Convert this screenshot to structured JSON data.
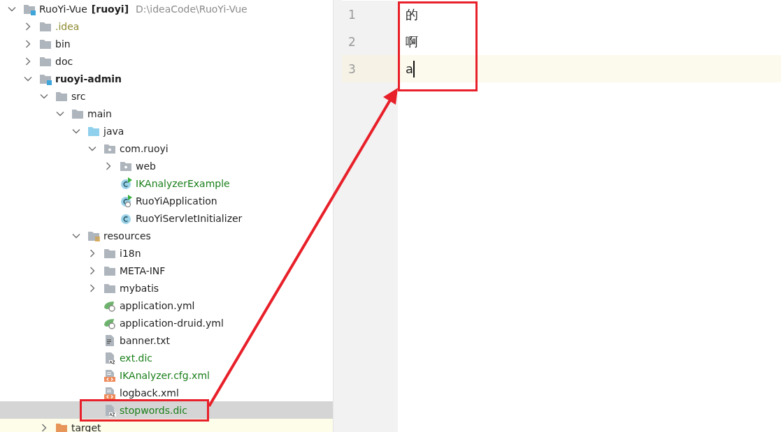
{
  "project_tree": {
    "items": [
      {
        "label": "RuoYi-Vue",
        "badge": "[ruoyi]",
        "path": "D:\\ideaCode\\RuoYi-Vue",
        "kind": "module",
        "expanded": true,
        "selected": false,
        "children": [
          {
            "label": ".idea",
            "kind": "folder",
            "expanded": false,
            "selected": false,
            "color": "#8c8a2f"
          },
          {
            "label": "bin",
            "kind": "folder",
            "expanded": false,
            "selected": false
          },
          {
            "label": "doc",
            "kind": "folder",
            "expanded": false,
            "selected": false
          },
          {
            "label": "ruoyi-admin",
            "kind": "module",
            "bold": true,
            "expanded": true,
            "selected": false,
            "children": [
              {
                "label": "src",
                "kind": "folder",
                "expanded": true,
                "selected": false,
                "children": [
                  {
                    "label": "main",
                    "kind": "folder",
                    "expanded": true,
                    "selected": false,
                    "children": [
                      {
                        "label": "java",
                        "kind": "source-folder",
                        "expanded": true,
                        "selected": false,
                        "children": [
                          {
                            "label": "com.ruoyi",
                            "kind": "package",
                            "expanded": true,
                            "selected": false,
                            "children": [
                              {
                                "label": "web",
                                "kind": "package",
                                "expanded": false,
                                "selected": false
                              },
                              {
                                "label": "IKAnalyzerExample",
                                "kind": "main-class",
                                "selected": false,
                                "color": "#1a7f1a"
                              },
                              {
                                "label": "RuoYiApplication",
                                "kind": "boot-class",
                                "selected": false
                              },
                              {
                                "label": "RuoYiServletInitializer",
                                "kind": "class",
                                "selected": false
                              }
                            ]
                          }
                        ]
                      },
                      {
                        "label": "resources",
                        "kind": "resources-folder",
                        "expanded": true,
                        "selected": false,
                        "children": [
                          {
                            "label": "i18n",
                            "kind": "folder",
                            "expanded": false,
                            "selected": false
                          },
                          {
                            "label": "META-INF",
                            "kind": "folder",
                            "expanded": false,
                            "selected": false
                          },
                          {
                            "label": "mybatis",
                            "kind": "folder",
                            "expanded": false,
                            "selected": false
                          },
                          {
                            "label": "application.yml",
                            "kind": "spring-config",
                            "selected": false
                          },
                          {
                            "label": "application-druid.yml",
                            "kind": "spring-config",
                            "selected": false
                          },
                          {
                            "label": "banner.txt",
                            "kind": "text-file",
                            "selected": false
                          },
                          {
                            "label": "ext.dic",
                            "kind": "dic-file",
                            "selected": false,
                            "color": "#1a7f1a"
                          },
                          {
                            "label": "IKAnalyzer.cfg.xml",
                            "kind": "xml-file",
                            "selected": false,
                            "color": "#1a7f1a"
                          },
                          {
                            "label": "logback.xml",
                            "kind": "xml-file",
                            "selected": false
                          },
                          {
                            "label": "stopwords.dic",
                            "kind": "dic-file",
                            "selected": true,
                            "color": "#1a7f1a"
                          }
                        ]
                      }
                    ]
                  }
                ]
              },
              {
                "label": "target",
                "kind": "excluded-folder",
                "expanded": false,
                "selected": false
              }
            ]
          }
        ]
      }
    ]
  },
  "editor": {
    "lines": [
      {
        "number": "1",
        "text": "的",
        "current": false
      },
      {
        "number": "2",
        "text": "啊",
        "current": false
      },
      {
        "number": "3",
        "text": "a",
        "current": true
      }
    ]
  }
}
